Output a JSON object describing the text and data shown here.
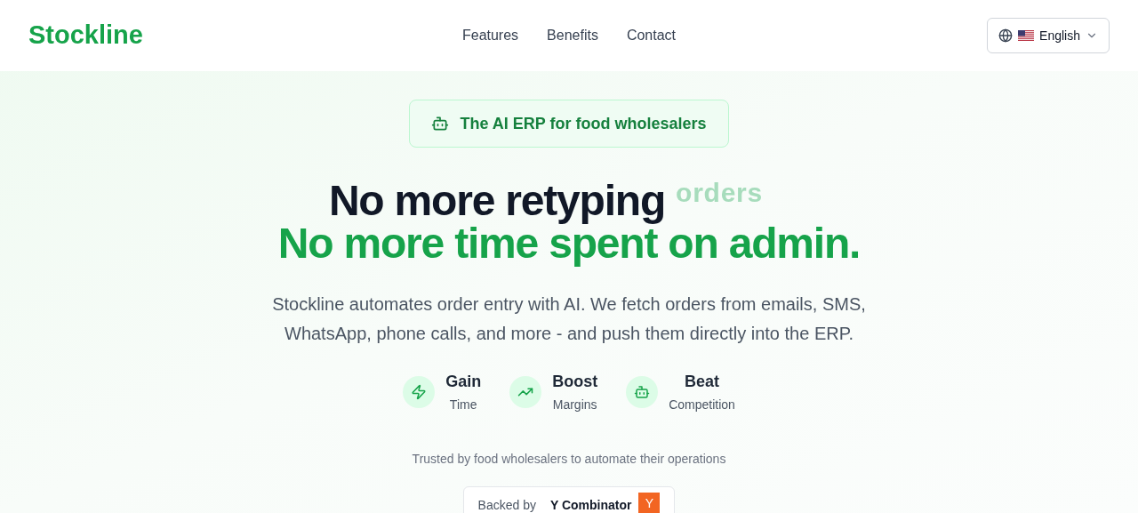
{
  "header": {
    "logo": "Stockline",
    "nav": [
      "Features",
      "Benefits",
      "Contact"
    ],
    "language": "English"
  },
  "hero": {
    "badge": "The AI ERP for food wholesalers",
    "headline_line1": "No more retyping",
    "rotating_word": "orders",
    "headline_line2": "No more time spent on admin.",
    "description": "Stockline automates order entry with AI. We fetch orders from emails, SMS, WhatsApp, phone calls, and more - and push them directly into the ERP.",
    "benefits": [
      {
        "title": "Gain",
        "subtitle": "Time"
      },
      {
        "title": "Boost",
        "subtitle": "Margins"
      },
      {
        "title": "Beat",
        "subtitle": "Competition"
      }
    ],
    "trusted": "Trusted by food wholesalers to automate their operations",
    "backed": {
      "label": "Backed by",
      "name": "Y Combinator",
      "logo_letter": "Y"
    }
  }
}
